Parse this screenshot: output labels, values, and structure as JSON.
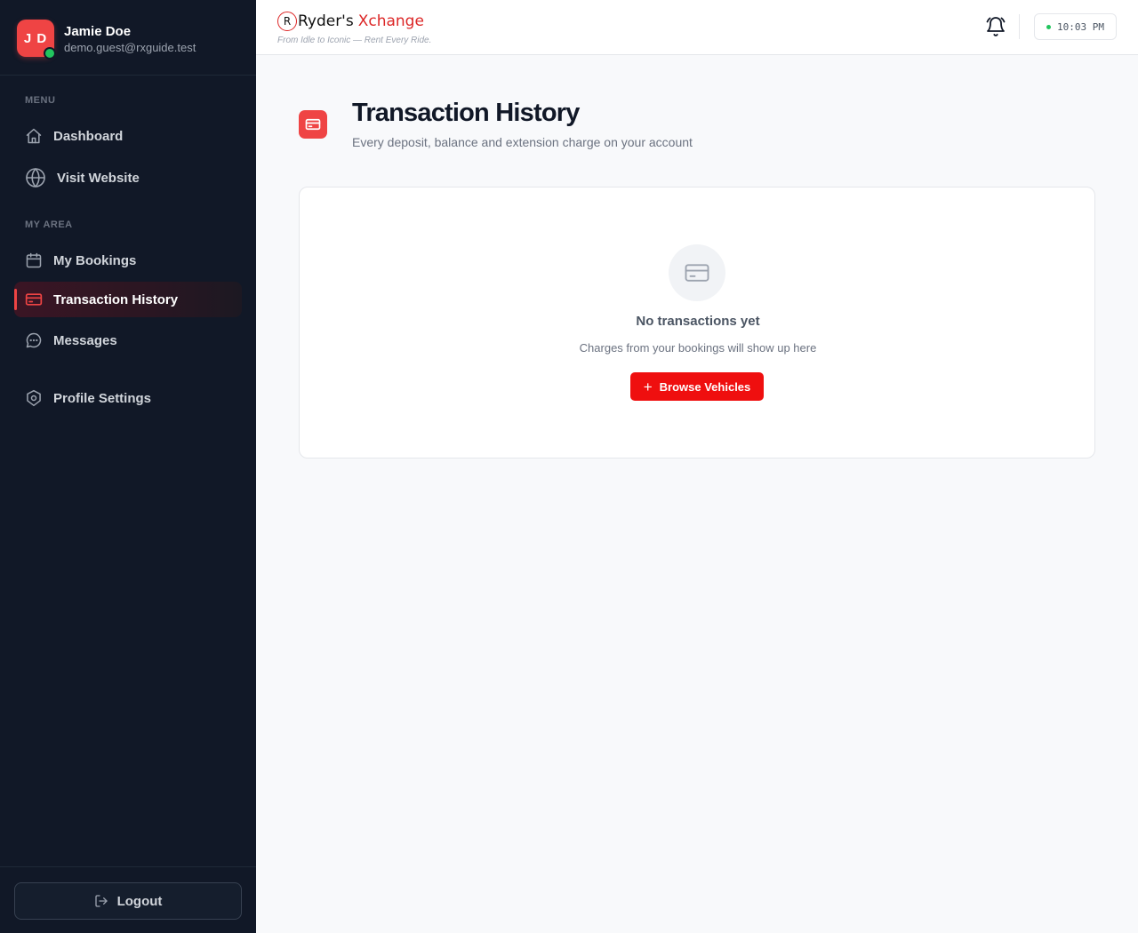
{
  "user": {
    "initials": "J D",
    "name": "Jamie Doe",
    "email": "demo.guest@rxguide.test"
  },
  "sidebar": {
    "menu_label": "MENU",
    "menu_items": [
      {
        "label": "Dashboard",
        "icon": "home-icon"
      },
      {
        "label": "Visit Website",
        "icon": "globe-icon"
      }
    ],
    "area_label": "MY AREA",
    "area_items": [
      {
        "label": "My Bookings",
        "icon": "calendar-icon"
      },
      {
        "label": "Transaction History",
        "icon": "credit-card-icon",
        "active": true
      },
      {
        "label": "Messages",
        "icon": "chat-bubble-icon"
      },
      {
        "label": "Profile Settings",
        "icon": "settings-icon"
      }
    ],
    "logout_label": "Logout"
  },
  "topbar": {
    "brand_badge": "R",
    "brand_name": "Ryder's",
    "brand_accent": "Xchange",
    "tagline": "From Idle to Iconic — Rent Every Ride.",
    "clock": "10:03 PM"
  },
  "main": {
    "title": "Transaction History",
    "subtitle": "Every deposit, balance and extension charge on your account",
    "empty_title": "No transactions yet",
    "empty_subtitle": "Charges from your bookings will show up here",
    "browse_label": "Browse Vehicles"
  },
  "colors": {
    "accent": "#ef4444",
    "button": "#ef0f0f",
    "sidebar_bg": "#111827",
    "online": "#22c55e"
  }
}
